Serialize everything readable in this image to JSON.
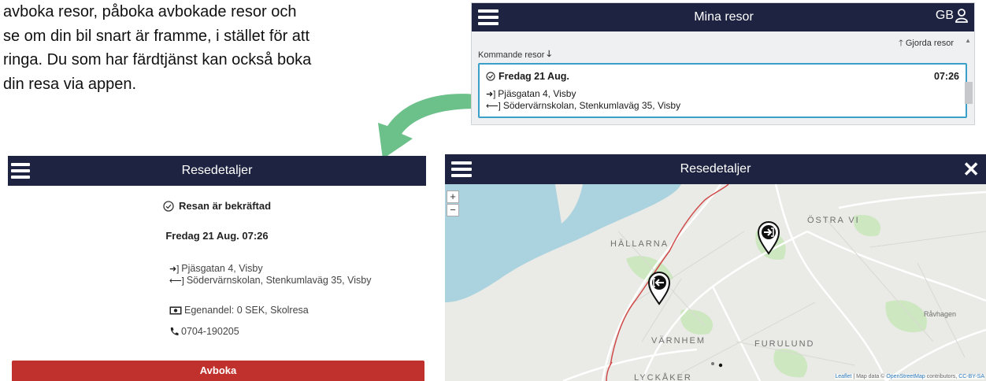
{
  "intro": {
    "lines": [
      "avboka resor, påboka avbokade resor och",
      "se om din bil snart är framme, i stället för att",
      "ringa. Du som har färdtjänst kan också boka",
      "din resa via appen."
    ]
  },
  "trips_screen": {
    "title": "Mina resor",
    "lang": "GB",
    "past_tab": "Gjorda resor",
    "coming_tab": "Kommande resor",
    "trip": {
      "date": "Fredag 21 Aug.",
      "time": "07:26",
      "from": "Pjäsgatan 4, Visby",
      "to": "Södervärnskolan, Stenkumlaväg 35, Visby"
    }
  },
  "details_screen": {
    "title": "Resedetaljer",
    "status": "Resan är bekräftad",
    "datetime": "Fredag 21 Aug. 07:26",
    "from": "Pjäsgatan 4, Visby",
    "to": "Södervärnskolan, Stenkumlaväg 35, Visby",
    "fee": "Egenandel: 0 SEK, Skolresa",
    "phone": "0704-190205",
    "cancel_label": "Avboka"
  },
  "map_screen": {
    "title": "Resedetaljer",
    "zoom_in": "+",
    "zoom_out": "−",
    "labels": {
      "hallarna": "HÄLLARNA",
      "ostra": "ÖSTRA VI",
      "ravhagen": "Råvhagen",
      "varnhem": "VÄRNHEM",
      "furulund": "FURULUND",
      "lyckaker": "LYCKÅKER"
    },
    "attribution": {
      "leaflet": "Leaflet",
      "map_data": " | Map data © ",
      "osm": "OpenStreetMap",
      "contributors": " contributors, ",
      "license": "CC-BY-SA"
    }
  },
  "colors": {
    "header": "#1d2340",
    "card_border": "#3aa0c8",
    "cancel_button": "#c0302c",
    "arrow": "#6cc08a",
    "water": "#aad3df"
  }
}
